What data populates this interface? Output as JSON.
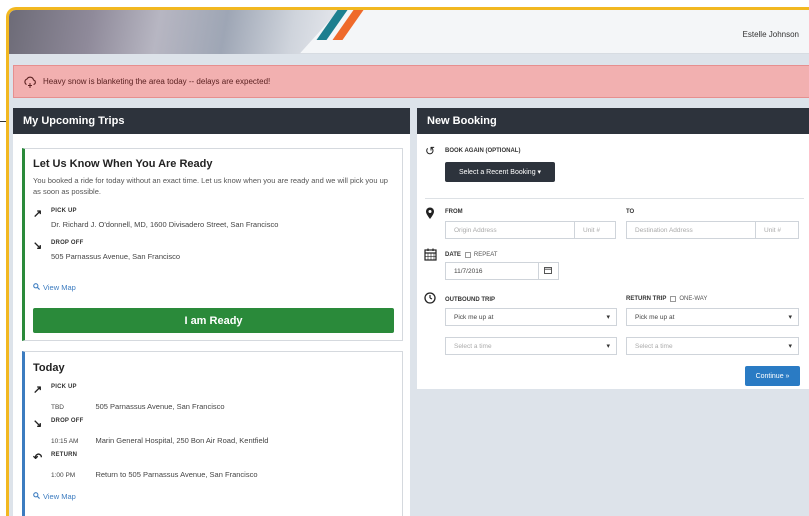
{
  "header": {
    "user_name": "Estelle Johnson",
    "accent_colors": {
      "teal": "#1d7f8f",
      "orange": "#ef6a2b",
      "frame": "#f2b820"
    }
  },
  "alert": {
    "icon": "cloud-snow-icon",
    "text": "Heavy snow is blanketing the area today -- delays are expected!"
  },
  "upcoming": {
    "title": "My Upcoming Trips",
    "ready_card": {
      "title": "Let Us Know When You Are Ready",
      "description": "You booked a ride for today without an exact time. Let us know when you are ready and we will pick you up as soon as possible.",
      "pickup_label": "PICK UP",
      "pickup_address": "Dr. Richard J. O'donnell, MD, 1600 Divisadero Street, San Francisco",
      "dropoff_label": "DROP OFF",
      "dropoff_address": "505 Parnassus Avenue, San Francisco",
      "view_map": "View Map",
      "ready_button": "I am Ready"
    },
    "today_card": {
      "title": "Today",
      "pickup_label": "PICK UP",
      "pickup_time": "TBD",
      "pickup_address": "505 Parnassus Avenue, San Francisco",
      "dropoff_label": "DROP OFF",
      "dropoff_time": "10:15 AM",
      "dropoff_address": "Marin General Hospital, 250 Bon Air Road, Kentfield",
      "return_label": "RETURN",
      "return_time": "1:00 PM",
      "return_address": "Return to 505 Parnassus Avenue, San Francisco",
      "view_map": "View Map"
    }
  },
  "booking": {
    "title": "New Booking",
    "book_again_label": "BOOK AGAIN (OPTIONAL)",
    "recent_button": "Select a Recent Booking ▾",
    "from_label": "FROM",
    "to_label": "TO",
    "origin_placeholder": "Origin Address",
    "unit_placeholder": "Unit #",
    "destination_placeholder": "Destination Address",
    "date_label": "DATE",
    "repeat_label": "REPEAT",
    "date_value": "11/7/2016",
    "outbound_label": "OUTBOUND TRIP",
    "return_label": "RETURN TRIP",
    "one_way_label": "ONE-WAY",
    "pickup_select": "Pick me up at",
    "time_select": "Select a time",
    "continue_button": "Continue »"
  }
}
